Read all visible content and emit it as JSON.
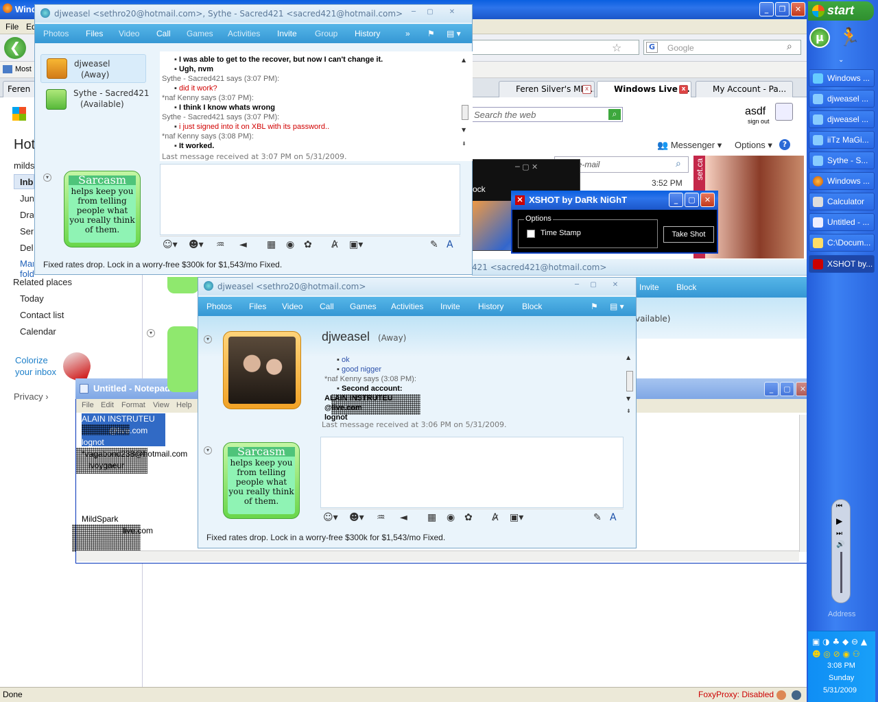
{
  "browser": {
    "title": "Windows Live",
    "menu": [
      "File",
      "Edit"
    ],
    "search_placeholder": "Google",
    "bookmarks": "Most Visited",
    "tabs": [
      {
        "label": "Feren"
      },
      {
        "label": "Feren Silver's MM..."
      },
      {
        "label": "Windows Live ..."
      },
      {
        "label": "My Account - Pa..."
      }
    ],
    "status": "Done",
    "foxyproxy": "FoxyProxy: Disabled"
  },
  "hotmail": {
    "brand": "Hotmail",
    "account": "mildspark",
    "folders": [
      "Inbox",
      "Junk",
      "Drafts",
      "Sent",
      "Deleted",
      "Manage folders"
    ],
    "related_header": "Related places",
    "related": [
      "Today",
      "Contact list",
      "Calendar"
    ],
    "colorize": [
      "Colorize",
      "your inbox"
    ],
    "privacy": "Privacy",
    "search_placeholder": "Search the web",
    "user": "asdf",
    "sign_out": "sign out",
    "messenger_label": "Messenger",
    "options_label": "Options",
    "email_placeholder": "your e-mail",
    "time": "3:52 PM",
    "ad_site": "set.ca"
  },
  "conv1": {
    "title": "djweasel <sethro20@hotmail.com>, Sythe - Sacred421 <sacred421@hotmail.com>",
    "menu": [
      "Photos",
      "Files",
      "Video",
      "Call",
      "Games",
      "Activities",
      "Invite",
      "Group",
      "History"
    ],
    "contacts": [
      {
        "name": "djweasel",
        "status": "(Away)"
      },
      {
        "name": "Sythe - Sacred421",
        "status": "(Available)"
      }
    ],
    "lines": [
      {
        "t": "I was able to get to the recover, but now I can't change it.",
        "cls": "bold",
        "b": true
      },
      {
        "t": "Ugh, nvm",
        "cls": "bold",
        "b": true
      },
      {
        "t": "Sythe - Sacred421 says (3:07 PM):",
        "cls": "grey"
      },
      {
        "t": "did it work?",
        "cls": "red",
        "b": true
      },
      {
        "t": "*naf Kenny says (3:07 PM):",
        "cls": "grey"
      },
      {
        "t": "I think I know whats wrong",
        "cls": "bold",
        "b": true
      },
      {
        "t": "Sythe - Sacred421 says (3:07 PM):",
        "cls": "grey"
      },
      {
        "t": "i just signed into it on XBL with its password..",
        "cls": "red",
        "b": true
      },
      {
        "t": "*naf Kenny says (3:08 PM):",
        "cls": "grey"
      },
      {
        "t": "It worked.",
        "cls": "bold",
        "b": true
      }
    ],
    "last_message": "Last message received at 3:07 PM on 5/31/2009.",
    "ad": "Fixed rates drop. Lock in a worry-free $300k for $1,543/mo Fixed."
  },
  "sarcasm": {
    "head": "Sarcasm",
    "body": "helps keep you from telling people what you really think of them."
  },
  "conv2_behind": {
    "title_tail": "421 <sacred421@hotmail.com>",
    "invite": "Invite",
    "block": "Block",
    "status_tail": "vailable)"
  },
  "conv2": {
    "title": "djweasel <sethro20@hotmail.com>",
    "menu": [
      "Photos",
      "Files",
      "Video",
      "Call",
      "Games",
      "Activities",
      "Invite",
      "History",
      "Block"
    ],
    "contact_name": "djweasel",
    "contact_status": "(Away)",
    "lines": [
      {
        "t": "ok",
        "cls": "blue",
        "b": true
      },
      {
        "t": "good nigger",
        "cls": "blue",
        "b": true
      },
      {
        "t": "*naf Kenny says (3:08 PM):",
        "cls": "grey"
      },
      {
        "t": "Second account:",
        "cls": "bold",
        "b": true
      },
      {
        "t": "ALAIN INSTRUTEU",
        "cls": "bold"
      },
      {
        "t": "@live.com",
        "cls": "bold"
      },
      {
        "t": "lognot",
        "cls": "bold"
      }
    ],
    "last_message": "Last message received at 3:06 PM on 5/31/2009.",
    "ad": "Fixed rates drop. Lock in a worry-free $300k for $1,543/mo Fixed."
  },
  "notepad": {
    "title": "Untitled - Notepad",
    "menu": [
      "File",
      "Edit",
      "Format",
      "View",
      "Help"
    ],
    "lines": [
      "ALAIN INSTRUTEU",
      "@live.com",
      "lognot",
      "*vagabond238@hotmail.com",
      "lvoygaeur"
    ],
    "lines2": [
      "MildSpark",
      "live.com"
    ]
  },
  "xshot": {
    "title": "XSHOT by DaRk NiGhT",
    "group": "Options",
    "checkbox": "Time Stamp",
    "button": "Take Shot"
  },
  "black_window": {
    "label": "ock"
  },
  "taskbar": {
    "start": "start",
    "tasks": [
      "Windows ...",
      "djweasel ...",
      "djweasel ...",
      "iiTz MaGi...",
      "Sythe - S...",
      "Windows ...",
      "Calculator",
      "Untitled - ...",
      "C:\\Docum...",
      "XSHOT by..."
    ],
    "address": "Address",
    "time": "3:08 PM",
    "day": "Sunday",
    "date": "5/31/2009"
  },
  "icons": {
    "back": "back-arrow-icon",
    "star": "star-icon",
    "search": "magnifier-icon"
  }
}
